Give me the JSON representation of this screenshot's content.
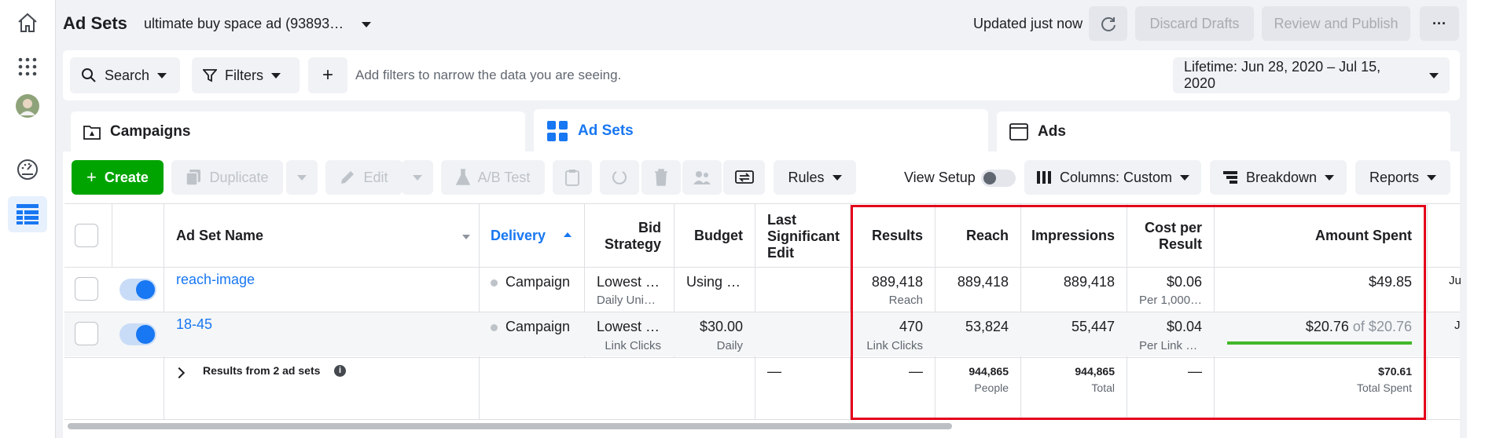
{
  "header": {
    "title": "Ad Sets",
    "account": "ultimate buy space ad (93893…",
    "updated": "Updated just now",
    "discard": "Discard Drafts",
    "review": "Review and Publish",
    "more": "···"
  },
  "filterbar": {
    "search": "Search",
    "filters": "Filters",
    "add": "+",
    "placeholder": "Add filters to narrow the data you are seeing.",
    "date_range": "Lifetime: Jun 28, 2020 – Jul 15, 2020"
  },
  "tabs": {
    "campaigns": "Campaigns",
    "adsets": "Ad Sets",
    "ads": "Ads"
  },
  "toolbar": {
    "create": "Create",
    "duplicate": "Duplicate",
    "edit": "Edit",
    "ab_test": "A/B Test",
    "rules": "Rules",
    "view_setup": "View Setup",
    "columns": "Columns: Custom",
    "breakdown": "Breakdown",
    "reports": "Reports"
  },
  "columns": {
    "name": "Ad Set Name",
    "delivery": "Delivery",
    "bid_1": "Bid",
    "bid_2": "Strategy",
    "budget": "Budget",
    "last_1": "Last",
    "last_2": "Significant",
    "last_3": "Edit",
    "results": "Results",
    "reach": "Reach",
    "impressions": "Impressions",
    "cpr_1": "Cost per",
    "cpr_2": "Result",
    "spent": "Amount Spent"
  },
  "rows": [
    {
      "name": "reach-image",
      "delivery": "Campaign",
      "bid": "Lowest …",
      "bid_sub": "Daily Uni…",
      "budget": "Using …",
      "results": "889,418",
      "results_sub": "Reach",
      "reach": "889,418",
      "impressions": "889,418",
      "cpr": "$0.06",
      "cpr_sub": "Per 1,000…",
      "spent": "$49.85",
      "edge": "Ju"
    },
    {
      "name": "18-45",
      "delivery": "Campaign",
      "bid": "Lowest …",
      "bid_sub": "Link Clicks",
      "budget": "$30.00",
      "budget_sub": "Daily",
      "results": "470",
      "results_sub": "Link Clicks",
      "reach": "53,824",
      "impressions": "55,447",
      "cpr": "$0.04",
      "cpr_sub": "Per Link …",
      "spent": "$20.76",
      "spent_of": "of $20.76",
      "spent_progress": 1.0,
      "edge": "J"
    }
  ],
  "summary": {
    "label": "Results from 2 ad sets",
    "last_edit": "—",
    "results": "—",
    "reach": "944,865",
    "reach_sub": "People",
    "impressions": "944,865",
    "impressions_sub": "Total",
    "cpr": "—",
    "spent": "$70.61",
    "spent_sub": "Total Spent"
  },
  "colors": {
    "accent": "#1877f2",
    "create": "#00a400",
    "highlight_box": "#e4001b",
    "progress": "#42b72a"
  }
}
